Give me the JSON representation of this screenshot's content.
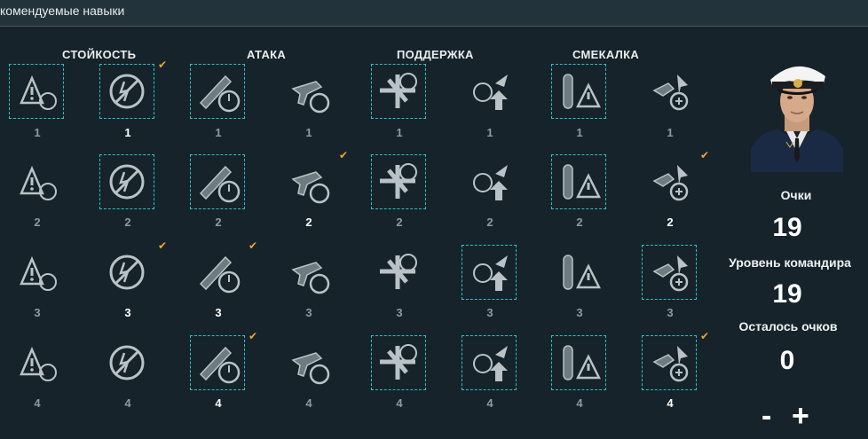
{
  "header": {
    "title": "комендуемые навыки"
  },
  "categories": [
    "СТОЙКОСТЬ",
    "АТАКА",
    "ПОДДЕРЖКА",
    "СМЕКАЛКА"
  ],
  "colors": {
    "accent_selected": "#29c3c9",
    "checkmark": "#f2a33a",
    "background": "#16232a"
  },
  "skills": [
    {
      "icon": "warning-circle-icon",
      "count": "1",
      "selected": true,
      "learned": false
    },
    {
      "icon": "no-fire-icon",
      "count": "1",
      "selected": true,
      "learned": true
    },
    {
      "icon": "gun-timer-icon",
      "count": "1",
      "selected": true,
      "learned": false
    },
    {
      "icon": "plane-timer-icon",
      "count": "1",
      "selected": false,
      "learned": false
    },
    {
      "icon": "fighter-target-icon",
      "count": "1",
      "selected": true,
      "learned": false
    },
    {
      "icon": "plane-target-up-icon",
      "count": "1",
      "selected": false,
      "learned": false
    },
    {
      "icon": "torpedo-warning-icon",
      "count": "1",
      "selected": true,
      "learned": false
    },
    {
      "icon": "bomb-plane-plus-icon",
      "count": "1",
      "selected": false,
      "learned": false
    },
    {
      "icon": "wrench-timer-icon",
      "count": "2",
      "selected": false,
      "learned": false
    },
    {
      "icon": "stopwatch-icon",
      "count": "2",
      "selected": true,
      "learned": false
    },
    {
      "icon": "shell-timer-icon",
      "count": "2",
      "selected": true,
      "learned": false
    },
    {
      "icon": "shell-arrow-icon",
      "count": "2",
      "selected": false,
      "learned": true
    },
    {
      "icon": "shells-up-icon",
      "count": "2",
      "selected": true,
      "learned": false
    },
    {
      "icon": "plane-target-arrow-icon",
      "count": "2",
      "selected": false,
      "learned": false
    },
    {
      "icon": "torpedo-timer-icon",
      "count": "2",
      "selected": true,
      "learned": false
    },
    {
      "icon": "gears-wrench-icon",
      "count": "2",
      "selected": false,
      "learned": true
    },
    {
      "icon": "wrench-up-icon",
      "count": "3",
      "selected": false,
      "learned": false
    },
    {
      "icon": "aa-gun-up-icon",
      "count": "3",
      "selected": false,
      "learned": true
    },
    {
      "icon": "shells-timer-icon",
      "count": "3",
      "selected": false,
      "learned": true
    },
    {
      "icon": "plane-fire-icon",
      "count": "3",
      "selected": false,
      "learned": false
    },
    {
      "icon": "targets-up-icon",
      "count": "3",
      "selected": false,
      "learned": false
    },
    {
      "icon": "targets-plus-icon",
      "count": "3",
      "selected": true,
      "learned": false
    },
    {
      "icon": "torpedo-fire-icon",
      "count": "3",
      "selected": false,
      "learned": false
    },
    {
      "icon": "shell-warning-icon",
      "count": "3",
      "selected": true,
      "learned": false
    },
    {
      "icon": "gun-up-icon",
      "count": "4",
      "selected": false,
      "learned": false
    },
    {
      "icon": "extinguisher-icon",
      "count": "4",
      "selected": false,
      "learned": false
    },
    {
      "icon": "shells-cross-up-icon",
      "count": "4",
      "selected": true,
      "learned": true
    },
    {
      "icon": "planes-map-icon",
      "count": "4",
      "selected": false,
      "learned": false
    },
    {
      "icon": "targets-up-2-icon",
      "count": "4",
      "selected": true,
      "learned": false
    },
    {
      "icon": "plane-crosshair-icon",
      "count": "4",
      "selected": true,
      "learned": false
    },
    {
      "icon": "radar-icon",
      "count": "4",
      "selected": true,
      "learned": false
    },
    {
      "icon": "warning-down-icon",
      "count": "4",
      "selected": true,
      "learned": true
    }
  ],
  "commander": {
    "points_label": "Очки",
    "points_value": "19",
    "level_label": "Уровень командира",
    "level_value": "19",
    "remaining_label": "Осталось очков",
    "remaining_value": "0",
    "minus_label": "-",
    "plus_label": "+"
  }
}
